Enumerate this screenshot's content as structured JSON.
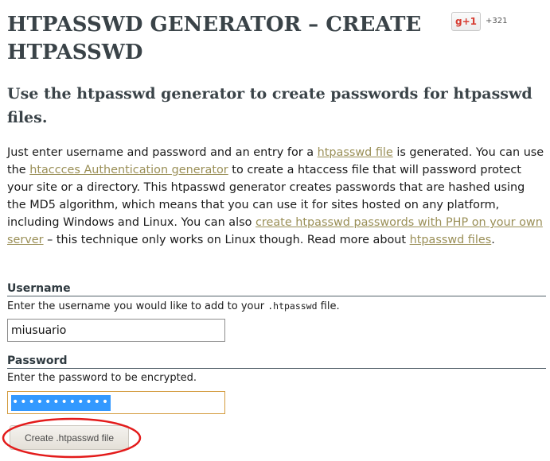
{
  "header": {
    "title": "HTPASSWD GENERATOR – CREATE HTPASSWD",
    "gplus_label": "g+1",
    "gplus_count": "+321"
  },
  "subtitle": "Use the htpasswd generator to create passwords for htpasswd files.",
  "intro": {
    "t1": "Just enter username and password and an entry for a ",
    "link1": "htpasswd file",
    "t2": " is generated. You can use the ",
    "link2": "htaccces Authentication generator",
    "t3": " to create a htaccess file that will password protect your site or a directory. This htpasswd generator creates passwords that are hashed using the MD5 algorithm, which means that you can use it for sites hosted on any platform, including Windows and Linux. You can also ",
    "link3": "create htpasswd passwords with PHP on your own server",
    "t4": " – this technique only works on Linux though. Read more about ",
    "link4": "htpasswd files",
    "t5": "."
  },
  "form": {
    "username": {
      "label": "Username",
      "desc_before": "Enter the username you would like to add to your ",
      "desc_code": ".htpasswd",
      "desc_after": " file.",
      "value": "miusuario"
    },
    "password": {
      "label": "Password",
      "desc": "Enter the password to be encrypted.",
      "masked_value": "••••••••••••"
    },
    "submit_label": "Create .htpasswd file"
  },
  "colors": {
    "heading": "#3a4348",
    "link": "#9a8f57",
    "annotation_ring": "#e31b1b",
    "selection": "#3399ff"
  }
}
